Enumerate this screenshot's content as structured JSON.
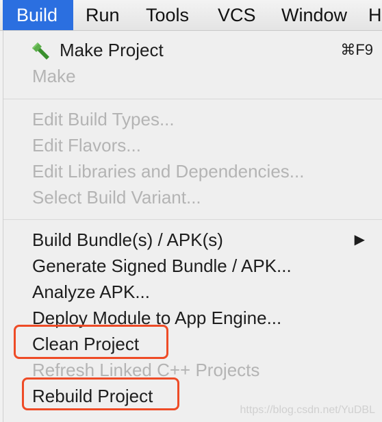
{
  "menubar": {
    "items": [
      {
        "label": "Build",
        "active": true
      },
      {
        "label": "Run",
        "active": false
      },
      {
        "label": "Tools",
        "active": false
      },
      {
        "label": "VCS",
        "active": false
      },
      {
        "label": "Window",
        "active": false
      },
      {
        "label": "H",
        "active": false
      }
    ]
  },
  "menu": {
    "groups": [
      [
        {
          "label": "Make Project",
          "shortcut": "⌘F9",
          "icon": "hammer-icon",
          "enabled": true
        },
        {
          "label": "Make",
          "enabled": false
        }
      ],
      [
        {
          "label": "Edit Build Types...",
          "enabled": false
        },
        {
          "label": "Edit Flavors...",
          "enabled": false
        },
        {
          "label": "Edit Libraries and Dependencies...",
          "enabled": false
        },
        {
          "label": "Select Build Variant...",
          "enabled": false
        }
      ],
      [
        {
          "label": "Build Bundle(s) / APK(s)",
          "submenu": true,
          "enabled": true
        },
        {
          "label": "Generate Signed Bundle / APK...",
          "enabled": true
        },
        {
          "label": "Analyze APK...",
          "enabled": true
        },
        {
          "label": "Deploy Module to App Engine...",
          "enabled": true
        },
        {
          "label": "Clean Project",
          "enabled": true,
          "highlighted": true
        },
        {
          "label": "Refresh Linked C++ Projects",
          "enabled": false
        },
        {
          "label": "Rebuild Project",
          "enabled": true,
          "highlighted": true
        }
      ]
    ]
  },
  "watermark": "https://blog.csdn.net/YuDBL",
  "colors": {
    "menubar_active": "#2b6fe0",
    "annotation_outline": "#ee4b26",
    "disabled_text": "#b4b4b4"
  }
}
